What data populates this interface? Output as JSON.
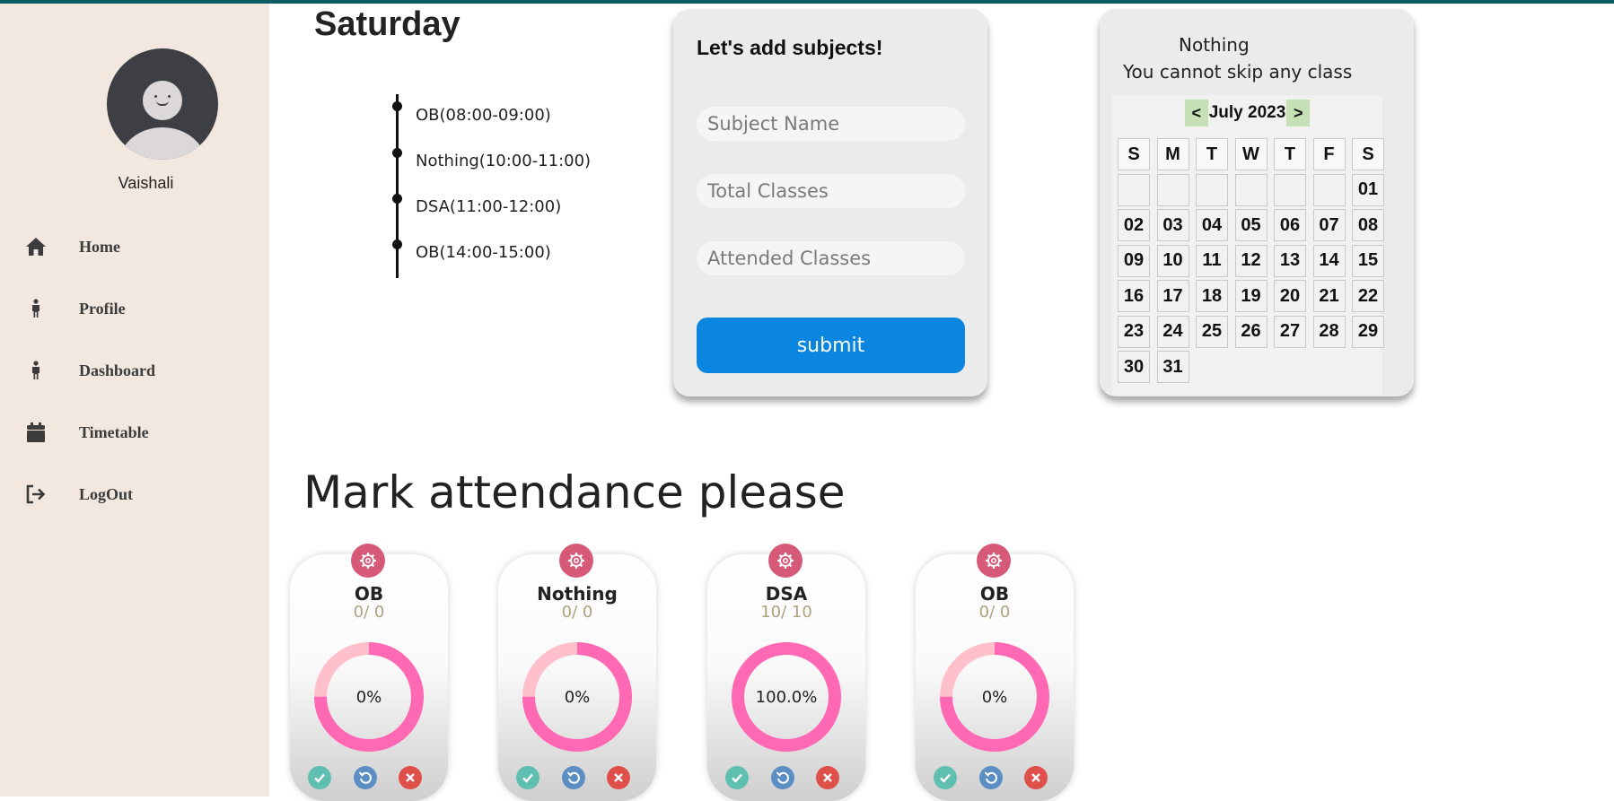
{
  "sidebar": {
    "username": "Vaishali",
    "items": [
      {
        "label": "Home",
        "icon": "home-icon"
      },
      {
        "label": "Profile",
        "icon": "person-icon"
      },
      {
        "label": "Dashboard",
        "icon": "person-icon"
      },
      {
        "label": "Timetable",
        "icon": "calendar-icon"
      },
      {
        "label": "LogOut",
        "icon": "logout-icon"
      }
    ]
  },
  "schedule": {
    "day": "Saturday",
    "entries": [
      "OB(08:00-09:00)",
      "Nothing(10:00-11:00)",
      "DSA(11:00-12:00)",
      "OB(14:00-15:00)"
    ]
  },
  "add_subject": {
    "title": "Let's add subjects!",
    "subject_placeholder": "Subject Name",
    "total_placeholder": "Total Classes",
    "attended_placeholder": "Attended Classes",
    "submit_label": "submit"
  },
  "calendar": {
    "subject": "Nothing",
    "message": "You cannot skip any class",
    "prev": "<",
    "next": ">",
    "month": "July 2023",
    "weekdays": [
      "S",
      "M",
      "T",
      "W",
      "T",
      "F",
      "S"
    ],
    "leading_blanks": 6,
    "days": [
      "01",
      "02",
      "03",
      "04",
      "05",
      "06",
      "07",
      "08",
      "09",
      "10",
      "11",
      "12",
      "13",
      "14",
      "15",
      "16",
      "17",
      "18",
      "19",
      "20",
      "21",
      "22",
      "23",
      "24",
      "25",
      "26",
      "27",
      "28",
      "29",
      "30",
      "31"
    ]
  },
  "attendance": {
    "title": "Mark attendance please",
    "cards": [
      {
        "name": "OB",
        "count": "0/ 0",
        "percent_label": "0%",
        "percent": 0
      },
      {
        "name": "Nothing",
        "count": "0/ 0",
        "percent_label": "0%",
        "percent": 0
      },
      {
        "name": "DSA",
        "count": "10/ 10",
        "percent_label": "100.0%",
        "percent": 100
      },
      {
        "name": "OB",
        "count": "0/ 0",
        "percent_label": "0%",
        "percent": 0
      }
    ]
  },
  "colors": {
    "sidebar_bg": "#f2e8df",
    "accent_blue": "#0a85e0",
    "donut_pink": "#ff69b4",
    "donut_light": "#ffc0cb",
    "gear_bg": "#d65a78",
    "present": "#5fbfb0",
    "undo": "#5b8fc4",
    "absent": "#e0504a"
  }
}
